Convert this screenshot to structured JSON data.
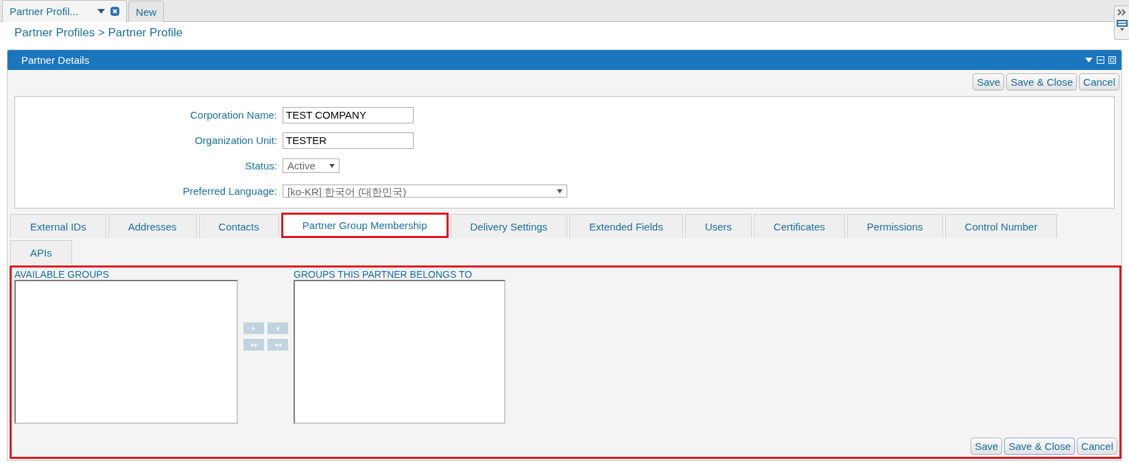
{
  "doc_tabs": [
    {
      "label": "Partner Profil...",
      "selected": true,
      "closable": true
    },
    {
      "label": "New",
      "selected": false,
      "closable": false
    }
  ],
  "breadcrumb": "Partner Profiles > Partner Profile",
  "panel": {
    "title": "Partner Details"
  },
  "top_buttons": [
    {
      "label": "Save",
      "focused": false
    },
    {
      "label": "Save & Close",
      "focused": false
    },
    {
      "label": "Cancel",
      "focused": false
    }
  ],
  "form": [
    {
      "kind": "text",
      "label": "Corporation Name:",
      "value": "TEST COMPANY"
    },
    {
      "kind": "text",
      "label": "Organization Unit:",
      "value": "TESTER"
    },
    {
      "kind": "select",
      "label": "Status:",
      "value": "Active"
    },
    {
      "kind": "wide-select",
      "label": "Preferred Language:",
      "value": "[ko-KR] 한국어 (대한민국)"
    }
  ],
  "tabs": [
    {
      "label": "External IDs",
      "selected": false
    },
    {
      "label": "Addresses",
      "selected": false
    },
    {
      "label": "Contacts",
      "selected": false
    },
    {
      "label": "Partner Group Membership",
      "selected": true
    },
    {
      "label": "Delivery Settings",
      "selected": false
    },
    {
      "label": "Extended Fields",
      "selected": false
    },
    {
      "label": "Users",
      "selected": false
    },
    {
      "label": "Certificates",
      "selected": false
    },
    {
      "label": "Permissions",
      "selected": false
    },
    {
      "label": "Control Number",
      "selected": false
    },
    {
      "label": "APIs",
      "selected": false
    }
  ],
  "membership": {
    "available_label": "AVAILABLE GROUPS",
    "member_label": "GROUPS THIS PARTNER BELONGS TO"
  },
  "bottom_buttons": [
    {
      "label": "Save",
      "focused": false
    },
    {
      "label": "Save & Close",
      "focused": true
    },
    {
      "label": "Cancel",
      "focused": false
    }
  ]
}
